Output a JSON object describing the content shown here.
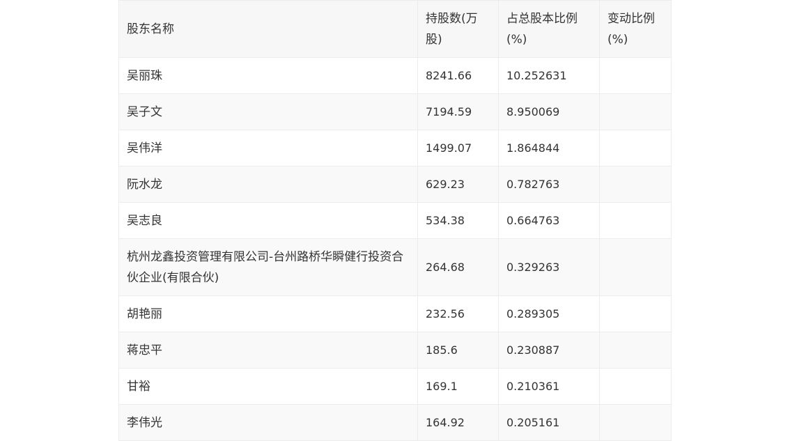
{
  "table": {
    "headers": [
      "股东名称",
      "持股数(万股)",
      "占总股本比例(%)",
      "变动比例(%)"
    ],
    "rows": [
      {
        "name": "吴丽珠",
        "shares": "8241.66",
        "ratio": "10.252631",
        "change": ""
      },
      {
        "name": "吴子文",
        "shares": "7194.59",
        "ratio": "8.950069",
        "change": ""
      },
      {
        "name": "吴伟洋",
        "shares": "1499.07",
        "ratio": "1.864844",
        "change": ""
      },
      {
        "name": "阮水龙",
        "shares": "629.23",
        "ratio": "0.782763",
        "change": ""
      },
      {
        "name": "吴志良",
        "shares": "534.38",
        "ratio": "0.664763",
        "change": ""
      },
      {
        "name": "杭州龙鑫投资管理有限公司-台州路桥华瞬健行投资合伙企业(有限合伙)",
        "shares": "264.68",
        "ratio": "0.329263",
        "change": ""
      },
      {
        "name": "胡艳丽",
        "shares": "232.56",
        "ratio": "0.289305",
        "change": ""
      },
      {
        "name": "蒋忠平",
        "shares": "185.6",
        "ratio": "0.230887",
        "change": ""
      },
      {
        "name": "甘裕",
        "shares": "169.1",
        "ratio": "0.210361",
        "change": ""
      },
      {
        "name": "李伟光",
        "shares": "164.92",
        "ratio": "0.205161",
        "change": ""
      }
    ]
  }
}
